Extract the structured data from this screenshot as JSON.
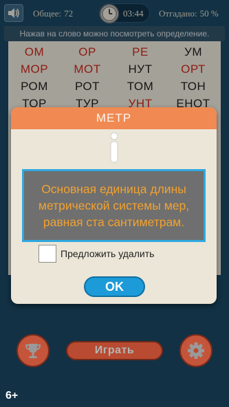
{
  "header": {
    "total_label": "Общее:",
    "total_value": "72",
    "time": "03:44",
    "guessed_label": "Отгадано:",
    "guessed_value": "50 %"
  },
  "hint": "Нажав на слово можно посмотреть определение.",
  "words": [
    {
      "text": "ОМ",
      "color": "red"
    },
    {
      "text": "ОР",
      "color": "red"
    },
    {
      "text": "РЕ",
      "color": "red"
    },
    {
      "text": "УМ",
      "color": "black"
    },
    {
      "text": "МОР",
      "color": "red"
    },
    {
      "text": "МОТ",
      "color": "red"
    },
    {
      "text": "НУТ",
      "color": "black"
    },
    {
      "text": "ОРТ",
      "color": "red"
    },
    {
      "text": "РОМ",
      "color": "black"
    },
    {
      "text": "РОТ",
      "color": "black"
    },
    {
      "text": "ТОМ",
      "color": "black"
    },
    {
      "text": "ТОН",
      "color": "black"
    },
    {
      "text": "ТОР",
      "color": "black"
    },
    {
      "text": "ТУР",
      "color": "black"
    },
    {
      "text": "УНТ",
      "color": "red"
    },
    {
      "text": "ЕНОТ",
      "color": "black"
    }
  ],
  "dialog": {
    "title": "МЕТР",
    "definition": "Основная единица длины метрической системы мер, равная ста сантиметрам.",
    "suggest_delete_label": "Предложить удалить",
    "ok_label": "OK"
  },
  "bottom": {
    "play_label": "Играть",
    "age_rating": "6+"
  },
  "colors": {
    "background": "#1c4a66",
    "accent_orange": "#f08a52",
    "word_red": "#d42a1e",
    "ok_blue": "#1c9bd8",
    "definition_text": "#f2a230"
  },
  "icons": [
    "speaker-icon",
    "clock-icon",
    "info-icon",
    "trophy-icon",
    "gear-icon"
  ]
}
